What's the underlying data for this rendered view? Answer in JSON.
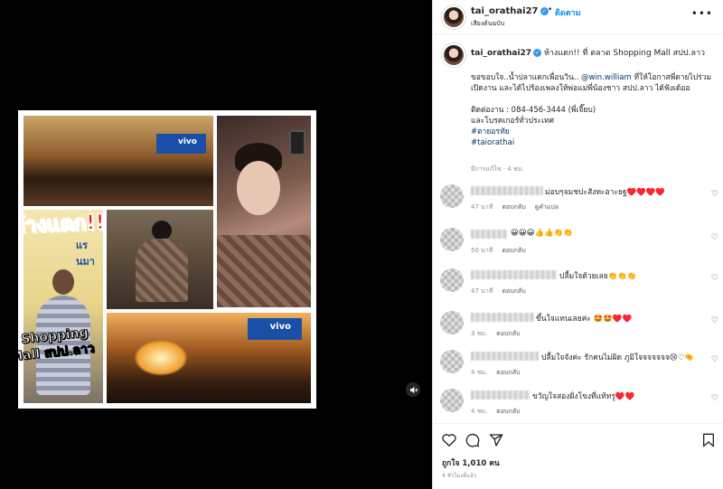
{
  "post": {
    "overlay_title": "ห้างแตก!!",
    "overlay_location": "ที่ Shopping Mall สปป.ลาว",
    "vivo_text": "vivo",
    "sign_text": "แรนมา"
  },
  "header": {
    "username": "tai_orathai27",
    "dot": "•",
    "follow_label": "ติดตาม",
    "subtitle": "เสียงต้นฉบับ",
    "more": "•••"
  },
  "caption": {
    "username": "tai_orathai27",
    "headline": "ห้างแตก!! ที่ ตลาด Shopping Mall สปป.ลาว",
    "line1": "ขอขอบใจ..น้ำปลาแดกเพื่อนวิน.. ",
    "mention": "@win.william",
    "line1b": " ที่ให้โอกาสพี่ตายไปร่วมเปิดงาน และได้ไปร้องเพลงให้พ่อแม่พี่น้องชาว สปป.ลาว ได้ฟังเด้ออ",
    "contact": "ติดต่องาน : 084-456-3444 (พี่เจี๊ยบ)",
    "contact2": "และโบรคเกอร์ทั่วประเทศ",
    "hashtag1": "#ตายอรทัย",
    "hashtag2": "#taiorathai",
    "meta": "มีการแก้ไข · 4 ชม."
  },
  "comments": [
    {
      "text": "ม่อบๆจมชปะสังทะอาะยฐ♥️♥️♥️♥️",
      "time": "47 นาที",
      "reply": "ตอบกลับ",
      "translate": "ดูคำแปล"
    },
    {
      "text": "😀😀😀👍👍👏👏",
      "time": "50 นาที",
      "reply": "ตอบกลับ",
      "translate": ""
    },
    {
      "text": "ปลื้มใจด้วยเลย👏👏👏",
      "time": "47 นาที",
      "reply": "ตอบกลับ",
      "translate": ""
    },
    {
      "text": "ขึ้นใจแทนเลยค่ะ 🤩🤩♥️♥️",
      "time": "3 ชม.",
      "reply": "ตอบกลับ",
      "translate": ""
    },
    {
      "text": "ปลื้มใจจังค่ะ รักคนไม่ผิด ภูมิใจจจจจจจ😢♡🤏",
      "time": "4 ชม.",
      "reply": "ตอบกลับ",
      "translate": ""
    },
    {
      "text": "ขวัญใจสองฝั่งโขงที่แท้ทรู♥️♥️",
      "time": "4 ชม.",
      "reply": "ตอบกลับ",
      "translate": ""
    }
  ],
  "actions": {
    "like_icon": "heart-icon",
    "comment_icon": "comment-icon",
    "share_icon": "share-icon",
    "save_icon": "bookmark-icon",
    "likes": "ถูกใจ 1,010 คน",
    "time": "4 ชั่วโมงที่แล้ว"
  },
  "colors": {
    "accent": "#0095f6",
    "verified": "#3897f0",
    "heart_red": "#e0245e"
  }
}
